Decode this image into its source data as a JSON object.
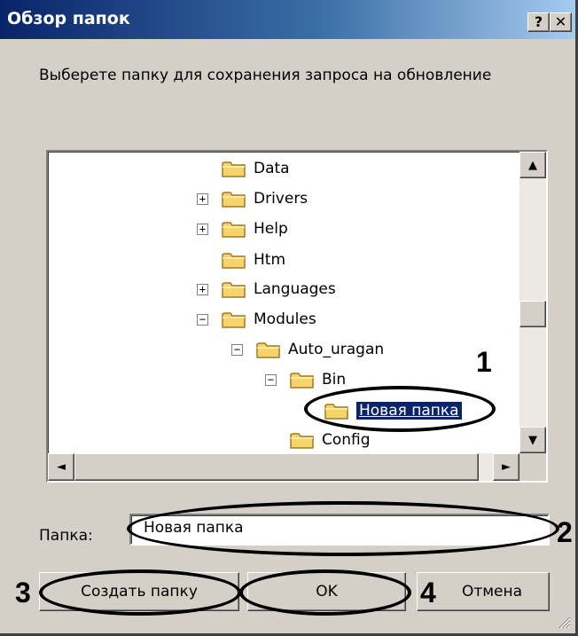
{
  "window": {
    "title": "Обзор папок",
    "help_label": "?",
    "close_label": "✕"
  },
  "instruction": "Выберете папку для сохранения запроса на обновление",
  "tree": {
    "items": [
      {
        "label": "Data",
        "expander": ""
      },
      {
        "label": "Drivers",
        "expander": "+"
      },
      {
        "label": "Help",
        "expander": "+"
      },
      {
        "label": "Htm",
        "expander": ""
      },
      {
        "label": "Languages",
        "expander": "+"
      },
      {
        "label": "Modules",
        "expander": "−"
      },
      {
        "label": "Auto_uragan",
        "expander": "−"
      },
      {
        "label": "Bin",
        "expander": "−"
      },
      {
        "label": "Новая папка",
        "expander": "",
        "selected": true
      },
      {
        "label": "Config",
        "expander": ""
      }
    ]
  },
  "scrollbar": {
    "up": "▲",
    "down": "▼",
    "left": "◄",
    "right": "►"
  },
  "folder_field": {
    "label": "Папка:",
    "value": "Новая папка"
  },
  "buttons": {
    "create": "Создать папку",
    "ok": "OK",
    "cancel": "Отмена"
  },
  "callouts": {
    "n1": "1",
    "n2": "2",
    "n3": "3",
    "n4": "4"
  },
  "colors": {
    "title_bar_start": "#0a246a",
    "title_bar_end": "#a6caf0",
    "dialog_face": "#d4d0c8",
    "selection": "#0a246a",
    "folder_yellow": "#f6d36b"
  }
}
